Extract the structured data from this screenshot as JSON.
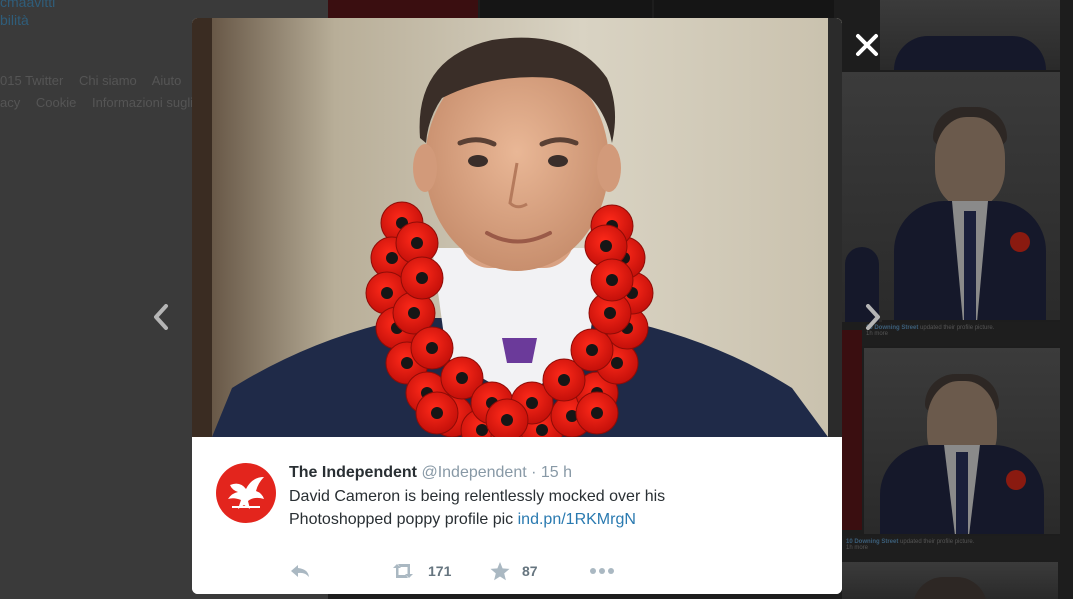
{
  "background": {
    "left_column_lines": [
      "cmaavitti",
      "bilità"
    ],
    "footer_links": [
      "015 Twitter",
      "Chi siamo",
      "Aiuto",
      "acy",
      "Cookie",
      "Informazioni sugli annunci"
    ],
    "thumb_captions": [
      {
        "name": "10 Downing Street",
        "text": "updated their profile picture.",
        "sub": "1h more"
      },
      {
        "name": "10 Downing Street",
        "text": "updated their profile picture.",
        "sub": "1h more"
      }
    ]
  },
  "lightbox": {
    "close_icon": "close-icon",
    "prev_icon": "chevron-left-icon",
    "next_icon": "chevron-right-icon"
  },
  "tweet": {
    "author_name": "The Independent",
    "author_handle": "@Independent",
    "separator": "·",
    "timestamp": "15 h",
    "text_line1": "David Cameron is being relentlessly mocked over his",
    "text_line2": "Photoshopped poppy profile pic",
    "link_text": "ind.pn/1RKMrgN",
    "retweet_count": "171",
    "favorite_count": "87",
    "avatar_color": "#e3251d",
    "link_color": "#2a7ab0"
  }
}
